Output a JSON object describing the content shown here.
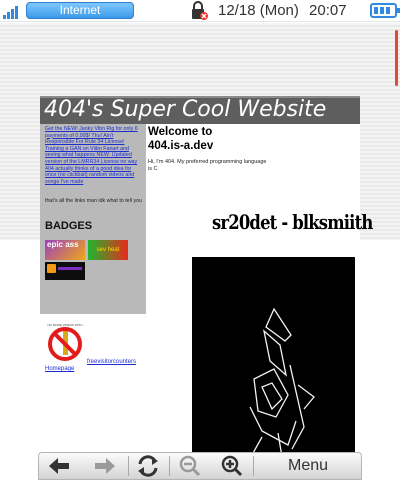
{
  "status_bar": {
    "app_tab": "Internet",
    "date": "12/18 (Mon)",
    "time": "20:07",
    "accent_color": "#2f8ae0"
  },
  "page": {
    "site_title": "404's Super Cool Website",
    "sidebar_links": "Get the NEW! Janky Vibn Rig for only 6 payments of 0.99$! Thu! Ain't Responsible For Rule 34 License! Training a GAN on Viibn Fanart and seeing what happens NEW: Updated version of the LMRR34 License no way 404 actually thinks of a good idea for once (no clickbait) random videos and songs I've made",
    "sidebar_note": "that's all the links man idk what to tell you",
    "badges_heading": "BADGES",
    "badge_epic": "epic ass",
    "badge_heat": "sev heat",
    "welcome_heading": "Welcome to 404.is-a.dev",
    "intro_text": "Hi, I'm 404. My preferred programming language is C",
    "author_banner": "sr20det - blksmiith",
    "no_sign_caption": "NO MORE VIDEOS WITH AUTOPLAY",
    "link_homepage": "Homepage",
    "link_counter": "freevisitorcounters"
  },
  "toolbar": {
    "menu_label": "Menu",
    "icons": [
      "back-arrow-icon",
      "forward-arrow-icon",
      "reload-icon",
      "zoom-out-icon",
      "zoom-in-icon"
    ]
  }
}
